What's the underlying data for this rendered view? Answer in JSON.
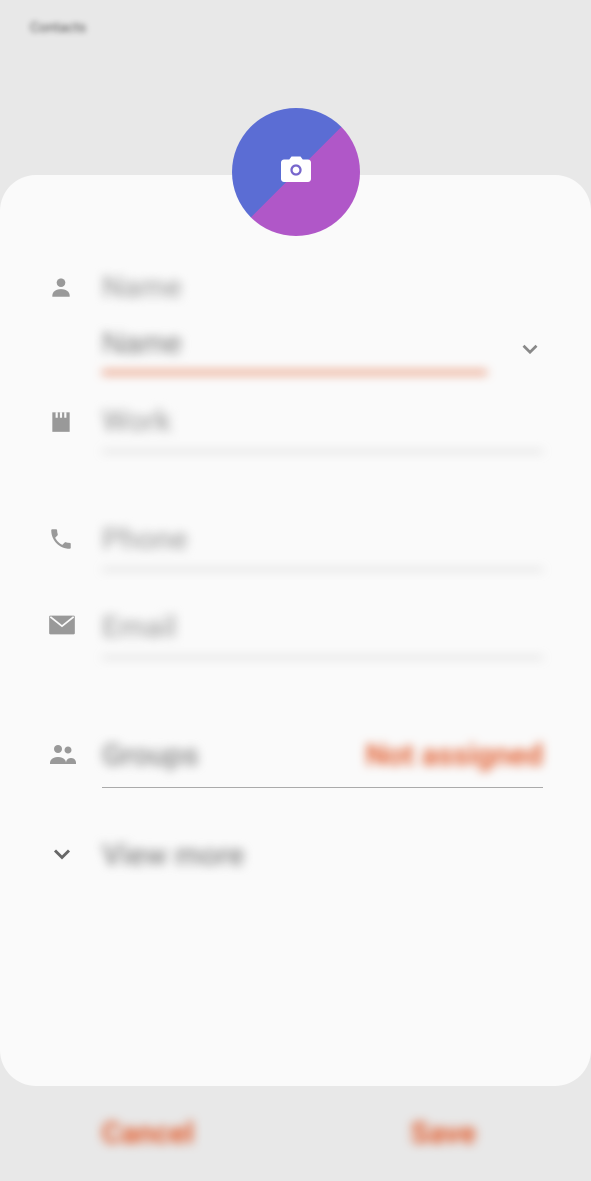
{
  "header": {
    "label": "Contacts"
  },
  "avatar": {
    "icon": "camera-icon"
  },
  "fields": {
    "name": {
      "label": "Name",
      "placeholder": "Name",
      "value": ""
    },
    "work": {
      "placeholder": "Work",
      "value": ""
    },
    "phone": {
      "placeholder": "Phone",
      "value": ""
    },
    "email": {
      "placeholder": "Email",
      "value": ""
    },
    "groups": {
      "label": "Groups",
      "value": "Not assigned"
    }
  },
  "viewmore": {
    "label": "View more"
  },
  "buttons": {
    "cancel": "Cancel",
    "save": "Save"
  },
  "colors": {
    "accent": "#e05a2b",
    "avatar_top": "#5b6dd4",
    "avatar_bottom": "#b057c8"
  }
}
